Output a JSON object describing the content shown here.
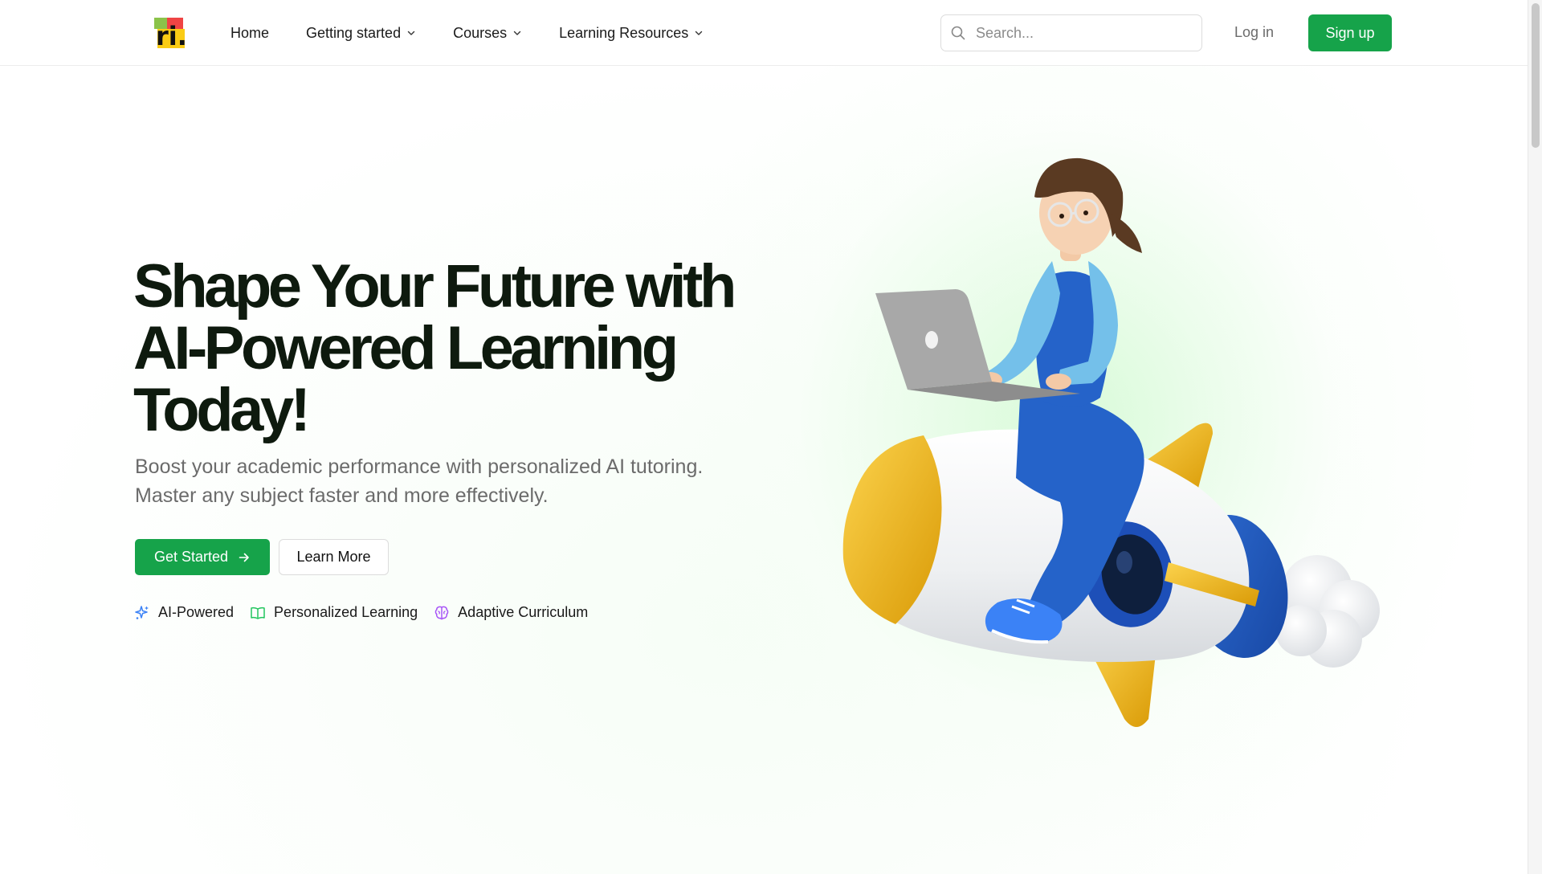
{
  "header": {
    "logo_text": "ri.",
    "nav": [
      {
        "label": "Home",
        "dropdown": false
      },
      {
        "label": "Getting started",
        "dropdown": true
      },
      {
        "label": "Courses",
        "dropdown": true
      },
      {
        "label": "Learning Resources",
        "dropdown": true
      }
    ],
    "search": {
      "placeholder": "Search...",
      "value": "",
      "icon": "search-icon"
    },
    "login_label": "Log in",
    "signup_label": "Sign up"
  },
  "hero": {
    "title_line1": "Shape Your Future with",
    "title_line2": "AI-Powered Learning",
    "title_line3": "Today!",
    "subtitle_line1": "Boost your academic performance with personalized AI tutoring.",
    "subtitle_line2": "Master any subject faster and more effectively.",
    "primary_button": "Get Started",
    "secondary_button": "Learn More",
    "features": [
      {
        "label": "AI-Powered",
        "icon": "sparkles-icon",
        "color": "#3b82f6"
      },
      {
        "label": "Personalized Learning",
        "icon": "book-open-icon",
        "color": "#22c55e"
      },
      {
        "label": "Adaptive Curriculum",
        "icon": "brain-icon",
        "color": "#a855f7"
      }
    ]
  },
  "colors": {
    "accent": "#16a34a",
    "title": "#0e1a0e",
    "muted": "#6b6b6b"
  }
}
